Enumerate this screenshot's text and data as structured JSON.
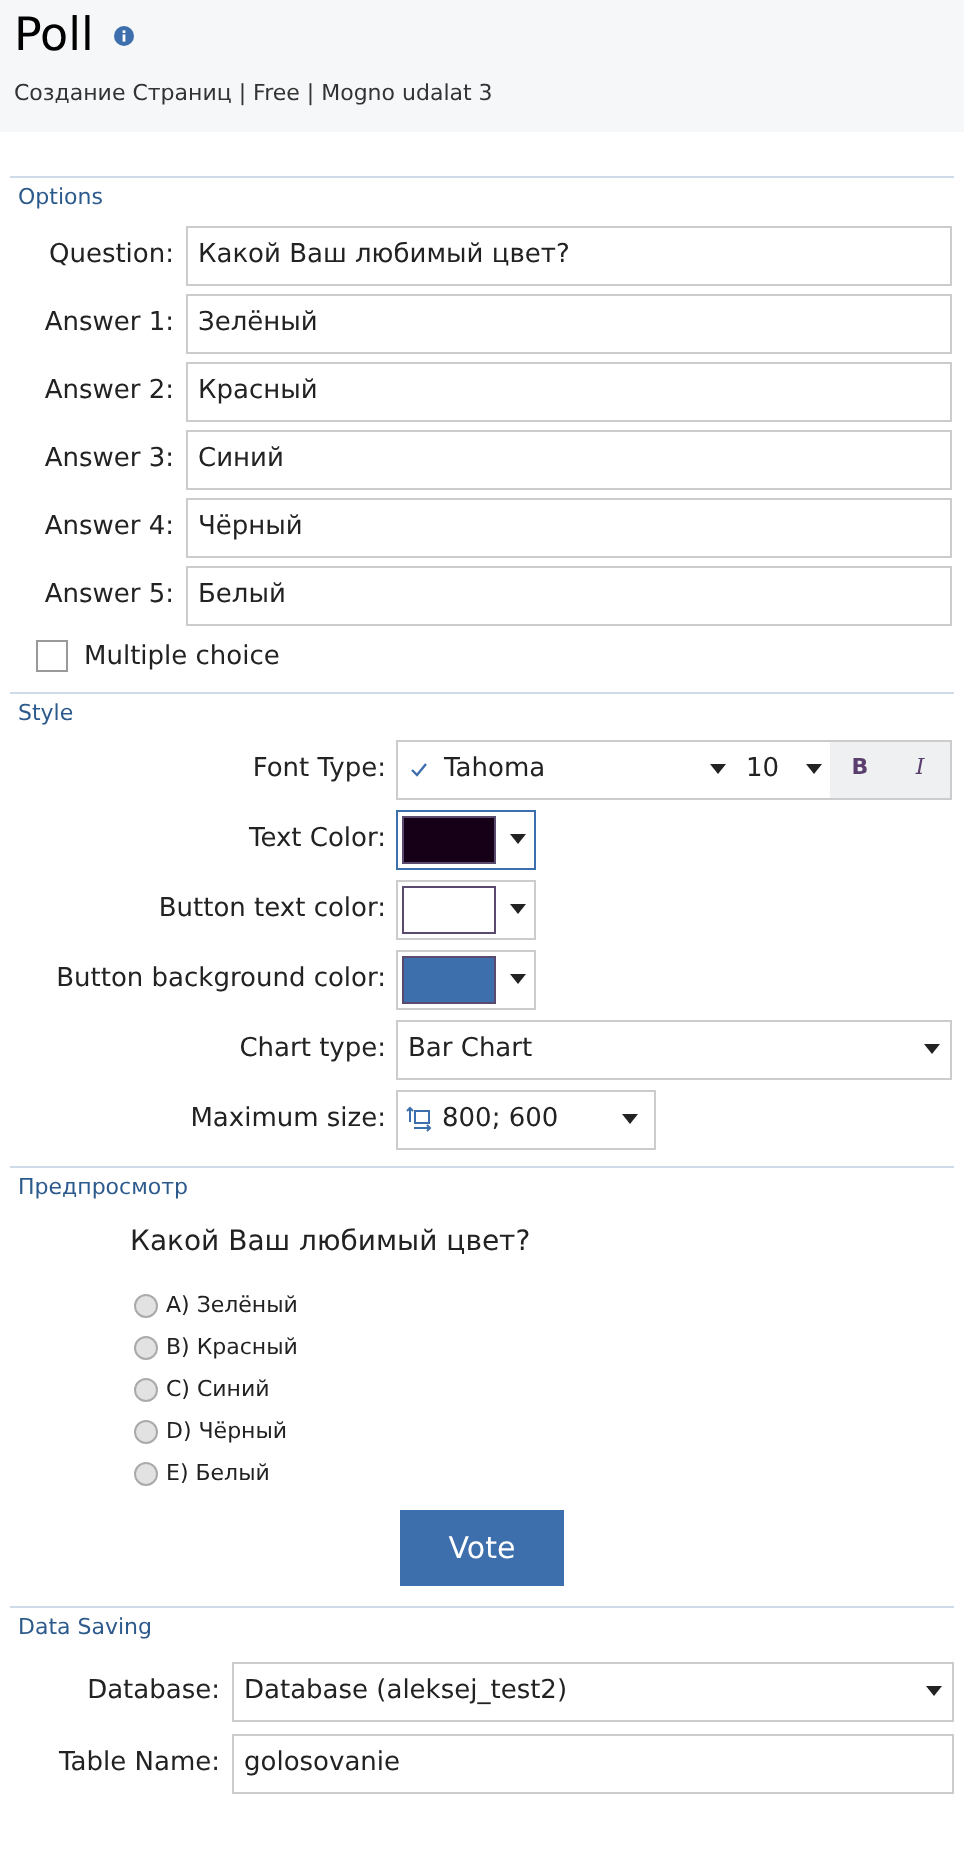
{
  "header": {
    "title": "Poll",
    "subtitle": "Создание Страниц | Free | Mogno udalat 3"
  },
  "options": {
    "heading": "Options",
    "fields": [
      {
        "label": "Question:",
        "value": "Какой Ваш любимый цвет?"
      },
      {
        "label": "Answer 1:",
        "value": "Зелёный"
      },
      {
        "label": "Answer 2:",
        "value": "Красный"
      },
      {
        "label": "Answer 3:",
        "value": "Синий"
      },
      {
        "label": "Answer 4:",
        "value": "Чёрный"
      },
      {
        "label": "Answer 5:",
        "value": "Белый"
      }
    ],
    "multiple_choice": {
      "label": "Multiple choice",
      "checked": false
    }
  },
  "style": {
    "heading": "Style",
    "font": {
      "label": "Font Type:",
      "family": "Tahoma",
      "size": "10",
      "bold_label": "B",
      "italic_label": "I",
      "bold": false,
      "italic": false
    },
    "colors": [
      {
        "label": "Text Color:",
        "color": "#150018",
        "focused": true
      },
      {
        "label": "Button text color:",
        "color": "#ffffff",
        "focused": false
      },
      {
        "label": "Button background color:",
        "color": "#3d6fad",
        "focused": false
      }
    ],
    "chart_type": {
      "label": "Chart type:",
      "value": "Bar Chart"
    },
    "max_size": {
      "label": "Maximum size:",
      "value": "800; 600"
    }
  },
  "preview": {
    "heading": "Предпросмотр",
    "question": "Какой Ваш любимый цвет?",
    "answers": [
      {
        "label": "A) Зелёный",
        "selected": false
      },
      {
        "label": "B) Красный",
        "selected": false
      },
      {
        "label": "C) Синий",
        "selected": false
      },
      {
        "label": "D) Чёрный",
        "selected": false
      },
      {
        "label": "E) Белый",
        "selected": false
      }
    ],
    "vote_button": "Vote"
  },
  "data_saving": {
    "heading": "Data Saving",
    "database": {
      "label": "Database:",
      "value": "Database (aleksej_test2)"
    },
    "table_name": {
      "label": "Table Name:",
      "value": "golosovanie"
    }
  }
}
